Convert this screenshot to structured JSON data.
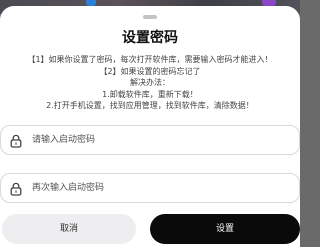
{
  "dialog": {
    "title": "设置密码",
    "notes": [
      "【1】如果你设置了密码，每次打开软件库，需要输入密码才能进入！",
      "【2】如果设置的密码忘记了",
      "解决办法：",
      "1.卸载软件库，重新下载！",
      "2.打开手机设置，找到应用管理，找到软件库，清除数据！"
    ]
  },
  "fields": {
    "password": {
      "placeholder": "请输入启动密码",
      "icon": "lock-icon"
    },
    "confirm": {
      "placeholder": "再次输入启动密码",
      "icon": "lock-icon"
    }
  },
  "buttons": {
    "cancel_label": "取消",
    "confirm_label": "设置"
  },
  "colors": {
    "confirm_bg": "#0a0a0a",
    "cancel_bg": "#eeeef0"
  }
}
